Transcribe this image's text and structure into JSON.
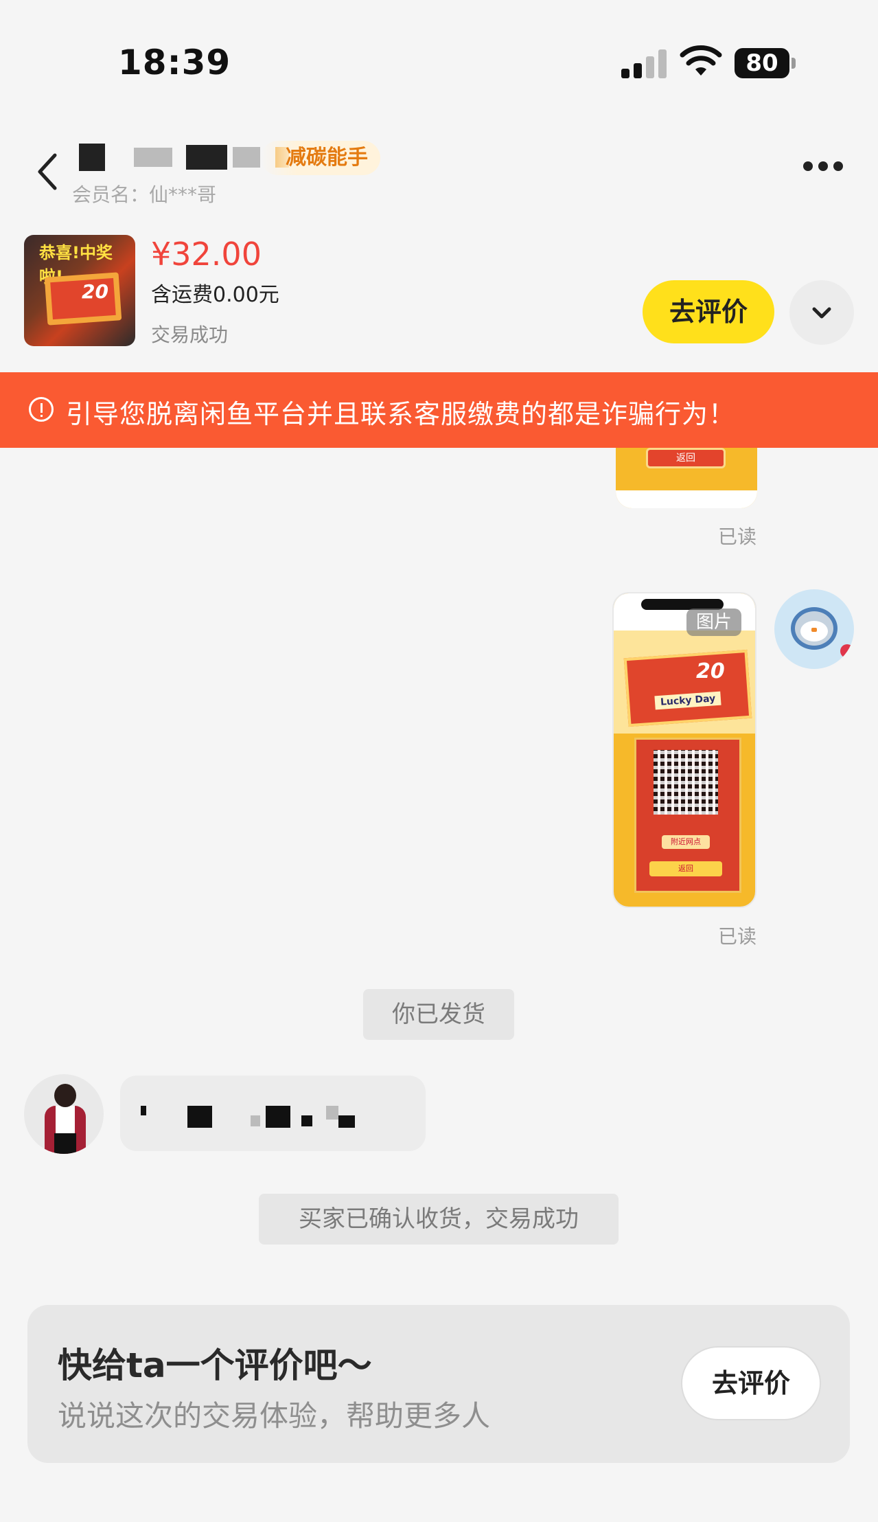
{
  "status_bar": {
    "time": "18:39",
    "battery": "80"
  },
  "header": {
    "badge": "减碳能手",
    "member_label": "会员名：仙***哥"
  },
  "product": {
    "thumb_title": "恭喜!中奖啦!",
    "thumb_number": "20",
    "price": "¥32.00",
    "shipping": "含运费0.00元",
    "status": "交易成功",
    "review_button": "去评价"
  },
  "warning": {
    "text": "引导您脱离闲鱼平台并且联系客服缴费的都是诈骗行为！"
  },
  "chat": {
    "image1": {
      "button_text": "返回",
      "read_status": "已读"
    },
    "image2": {
      "badge": "图片",
      "ticket_number": "20",
      "ticket_label": "Lucky Day",
      "btn_nearby": "附近网点",
      "btn_back": "返回",
      "read_status": "已读"
    },
    "system_shipped": "你已发货",
    "system_confirmed": "买家已确认收货，交易成功"
  },
  "review_card": {
    "title": "快给ta一个评价吧～",
    "subtitle": "说说这次的交易体验，帮助更多人",
    "button": "去评价"
  },
  "colors": {
    "accent_yellow": "#ffe01b",
    "warning_orange": "#fa5a32",
    "price_red": "#f0443b"
  }
}
